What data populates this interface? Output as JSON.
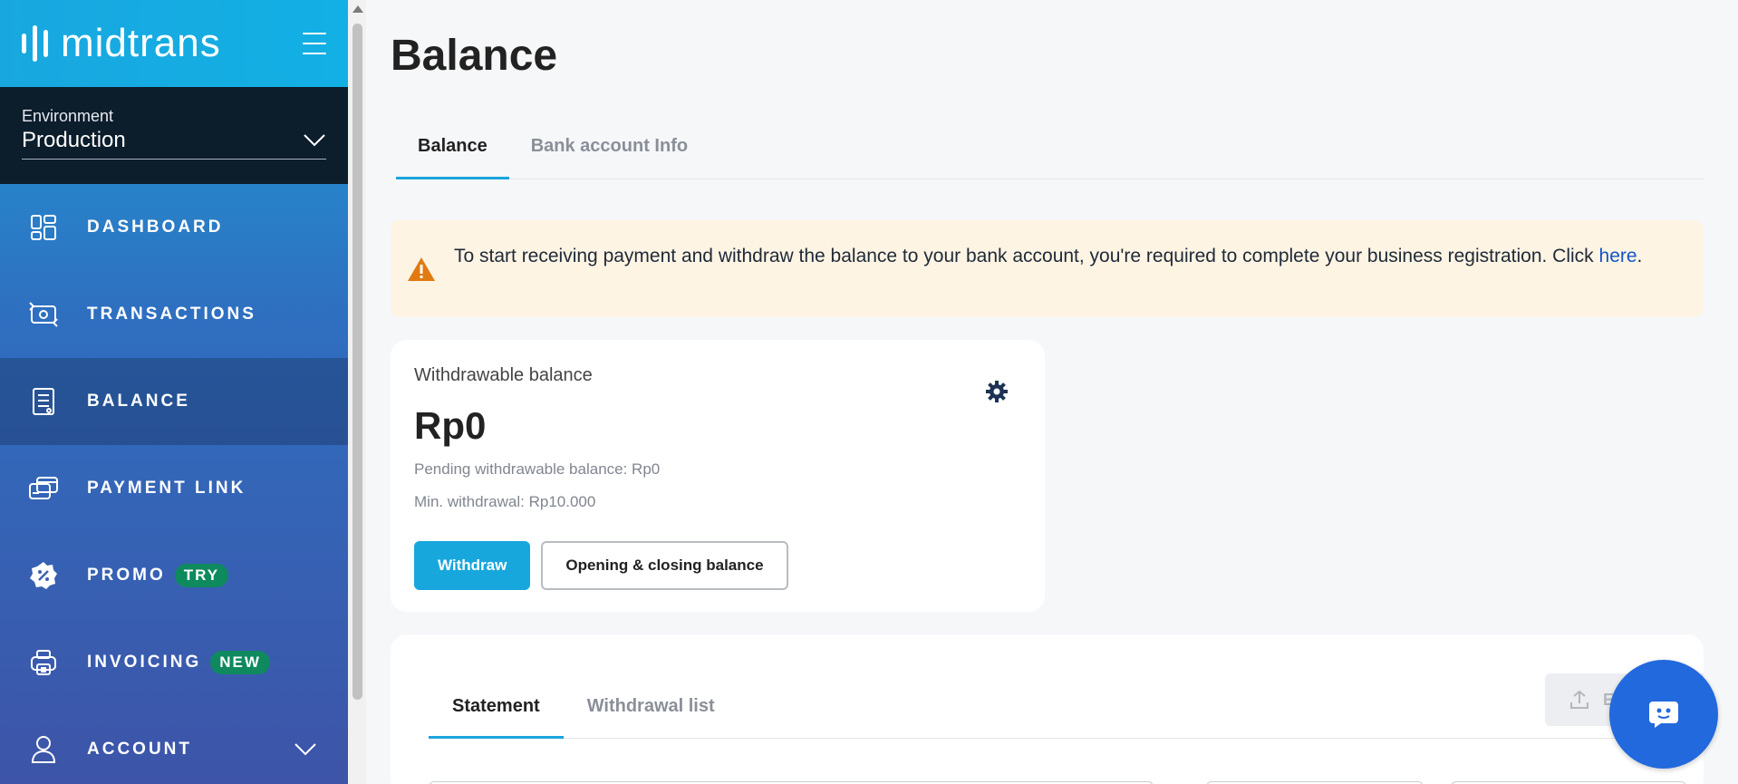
{
  "brand": {
    "logo_text": "midtrans"
  },
  "environment": {
    "label": "Environment",
    "value": "Production"
  },
  "sidebar": {
    "items": [
      {
        "label": "DASHBOARD",
        "icon": "dashboard-icon"
      },
      {
        "label": "TRANSACTIONS",
        "icon": "transactions-icon"
      },
      {
        "label": "BALANCE",
        "icon": "balance-icon",
        "active": true
      },
      {
        "label": "PAYMENT LINK",
        "icon": "payment-link-icon"
      },
      {
        "label": "PROMO",
        "icon": "promo-icon",
        "badge": "TRY"
      },
      {
        "label": "INVOICING",
        "icon": "invoicing-icon",
        "badge": "NEW"
      },
      {
        "label": "ACCOUNT",
        "icon": "user-icon",
        "expandable": true
      }
    ]
  },
  "page": {
    "title": "Balance"
  },
  "tabs": [
    {
      "label": "Balance",
      "active": true
    },
    {
      "label": "Bank account Info",
      "active": false
    }
  ],
  "alert": {
    "text": "To start receiving payment and withdraw the balance to your bank account, you're required to complete your business registration. Click",
    "link_text": "here",
    "suffix": "."
  },
  "balance_card": {
    "label": "Withdrawable balance",
    "amount": "Rp0",
    "pending": "Pending withdrawable balance: Rp0",
    "min_withdrawal": "Min. withdrawal: Rp10.000",
    "withdraw_button": "Withdraw",
    "opening_closing_button": "Opening & closing balance"
  },
  "statement": {
    "tabs": [
      {
        "label": "Statement",
        "active": true
      },
      {
        "label": "Withdrawal list",
        "active": false
      }
    ],
    "export_label": "Ex"
  },
  "colors": {
    "accent": "#18a7dc",
    "alert_bg": "#fef4e4",
    "alert_icon": "#e07a12",
    "badge": "#0f8a5f",
    "chat_fab": "#2269de"
  }
}
